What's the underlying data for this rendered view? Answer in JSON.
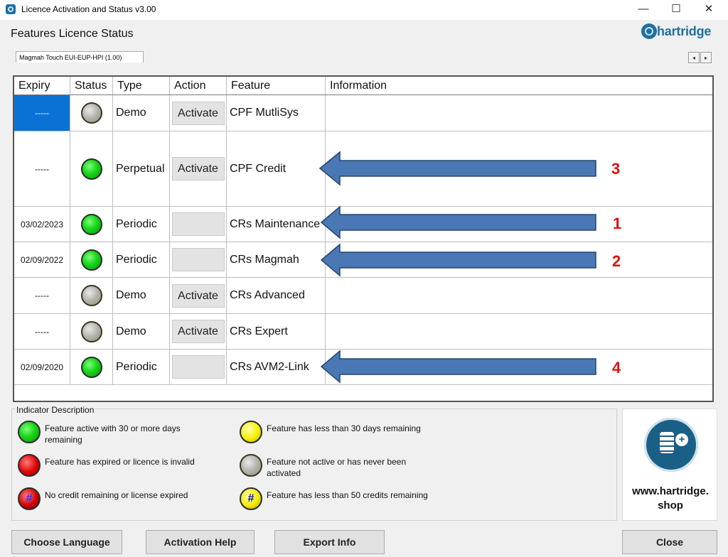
{
  "window": {
    "title": "Licence Activation and Status v3.00",
    "minimize": "—",
    "maximize": "☐",
    "close": "✕"
  },
  "header": {
    "title": "Features Licence Status",
    "logo": "hartridge"
  },
  "tab": {
    "label": "Magmah Touch EUI-EUP-HPI (1.00)",
    "scroll_left": "◂",
    "scroll_right": "▸"
  },
  "table": {
    "columns": [
      "Expiry",
      "Status",
      "Type",
      "Action",
      "Feature",
      "Information"
    ],
    "rows": [
      {
        "expiry": "-----",
        "status": "grey",
        "type": "Demo",
        "action": "Activate",
        "feature": "CPF MutliSys",
        "information": "",
        "selected": true
      },
      {
        "expiry": "-----",
        "status": "green",
        "type": "Perpetual",
        "action": "Activate",
        "feature": "CPF Credit",
        "information": ""
      },
      {
        "expiry": "03/02/2023",
        "status": "green",
        "type": "Periodic",
        "action": "",
        "feature": "CRs Maintenance",
        "information": ""
      },
      {
        "expiry": "02/09/2022",
        "status": "green",
        "type": "Periodic",
        "action": "",
        "feature": "CRs Magmah",
        "information": ""
      },
      {
        "expiry": "-----",
        "status": "grey",
        "type": "Demo",
        "action": "Activate",
        "feature": "CRs Advanced",
        "information": ""
      },
      {
        "expiry": "-----",
        "status": "grey",
        "type": "Demo",
        "action": "Activate",
        "feature": "CRs Expert",
        "information": ""
      },
      {
        "expiry": "02/09/2020",
        "status": "green",
        "type": "Periodic",
        "action": "",
        "feature": "CRs AVM2-Link",
        "information": ""
      }
    ]
  },
  "annotations": {
    "color": "#4a78b5",
    "number_color": "#e01010",
    "labels": [
      "3",
      "1",
      "2",
      "4"
    ]
  },
  "legend": {
    "title": "Indicator Description",
    "items": [
      {
        "icon": "green",
        "text": "Feature active with 30 or more days remaining"
      },
      {
        "icon": "yellow",
        "text": "Feature has less than 30 days remaining"
      },
      {
        "icon": "red",
        "text": "Feature has expired or licence is invalid"
      },
      {
        "icon": "grey",
        "text": "Feature not active or has never been activated"
      },
      {
        "icon": "red-hash",
        "text": "No credit remaining or license expired",
        "glyph": "#"
      },
      {
        "icon": "yellow-hash",
        "text": "Feature has less than 50 credits remaining",
        "glyph": "#"
      }
    ]
  },
  "promo": {
    "icon": "coins-plus-icon",
    "text_line1": "www.hartridge.",
    "text_line2": "shop"
  },
  "buttons": {
    "choose_language": "Choose Language",
    "activation_help": "Activation Help",
    "export_info": "Export Info",
    "close": "Close"
  }
}
